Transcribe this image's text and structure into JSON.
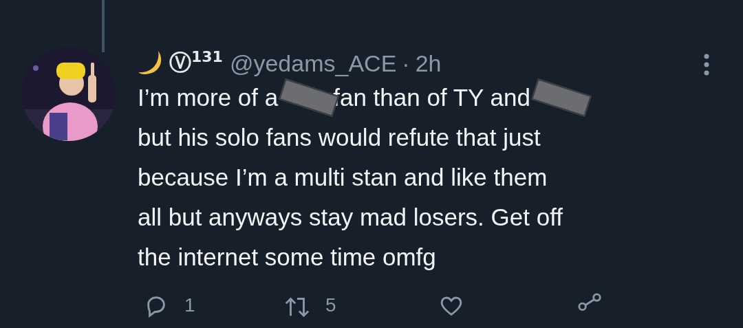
{
  "tweet": {
    "display_name": "Ⓥ$^{131}$",
    "handle": "@yedams_ACE",
    "separator": "·",
    "time": "2h",
    "lines": [
      {
        "segments": [
          {
            "kind": "text",
            "text": "I’m more of a"
          },
          {
            "kind": "redaction"
          },
          {
            "kind": "text",
            "text": "fan than of TY and"
          },
          {
            "kind": "redaction"
          }
        ]
      },
      {
        "segments": [
          {
            "kind": "text",
            "text": "but his solo fans would refute that just"
          }
        ]
      },
      {
        "segments": [
          {
            "kind": "text",
            "text": "because I’m a multi stan and like them"
          }
        ]
      },
      {
        "segments": [
          {
            "kind": "text",
            "text": "all but anyways stay mad losers. Get off"
          }
        ]
      },
      {
        "segments": [
          {
            "kind": "text",
            "text": "the internet some time omfg"
          }
        ]
      }
    ],
    "actions": [
      {
        "kind": "reply",
        "count": "1"
      },
      {
        "kind": "retweet",
        "count": "5"
      },
      {
        "kind": "like"
      },
      {
        "kind": "share"
      }
    ]
  }
}
